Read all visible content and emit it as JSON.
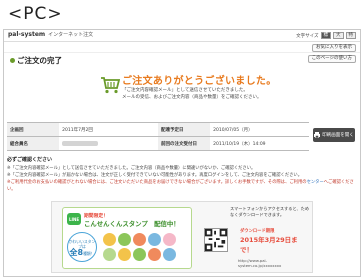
{
  "page_label": "<PC>",
  "header": {
    "brand": "pal-system",
    "brand_sub": "インターネット注文",
    "font_size_label": "文字サイズ",
    "font_sizes": [
      "標",
      "大",
      "特"
    ]
  },
  "member_button": "お気に入りを表示",
  "title": "ご注文の完了",
  "print_link": "このページの使い方",
  "thanks": {
    "message": "ご注文ありがとうございました。",
    "note1": "「ご注文内容確認メール」として送信させていただきました。",
    "note2": "メールの受信、およびご注文内容（商品や数量）をご確認ください。"
  },
  "info_rows": [
    {
      "h1": "企画回",
      "v1": "2011年7月2回",
      "h2": "配達予定日",
      "v2": "2010/07/05（月）"
    },
    {
      "h1": "組合員名",
      "v1": "",
      "h2": "前回の注文受付日",
      "v2": "2011/10/19（木）14:09"
    }
  ],
  "print_button": "印刷画面を開く",
  "notes": {
    "title": "必ずご確認ください",
    "items": [
      "※「ご注文内容確認メール」として送信させていただきました。ご注文内容（商品や数量）に間違いがないか、ご確認ください。",
      "※「ご注文内容確認メール」が届かない場合は、注文が正しく受付できていない可能性があります。再度ログインをして、ご注文内容をご確認ください。",
      "※ご利用代金のお支払いの確認がとれない場合には、ご注文いただいた商品をお届けできない場合がございます。詳しくお手数ですが、その際は、ご利用の"
    ],
    "link": "センター",
    "tail": "へご確認ください。"
  },
  "banner": {
    "line_logo": "LINE",
    "kikan": "期間限定！",
    "stamp": "こんせんくんスタンプ　配信中！",
    "eight_pre": "かわいいスタンプは",
    "eight_num": "全8",
    "eight_post": "種類！",
    "qr_text": "スマートフォンからアクセスすると、ためなくダウンロードできます。",
    "download": "ダウンロード期限",
    "date": "2015年3月29日まで！",
    "url": "http://www.pal-system.co.jp/xxxxxxxx"
  },
  "colors": {
    "accent_orange": "#e87a1e",
    "line_green": "#3cb44a",
    "cart_green": "#6a9b2a"
  }
}
